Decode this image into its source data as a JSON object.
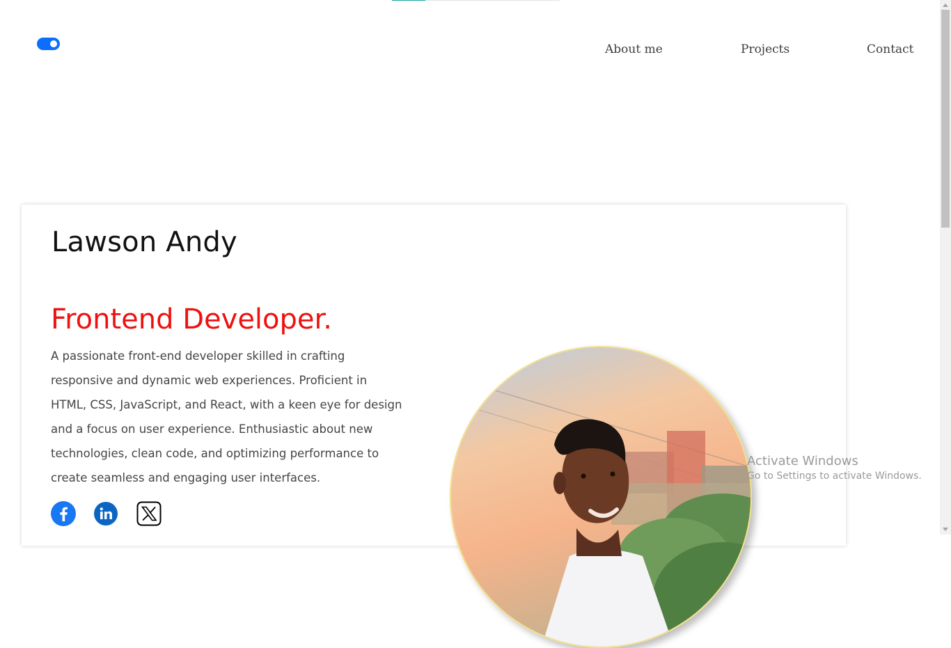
{
  "nav": {
    "about": "About me",
    "projects": "Projects",
    "contact": "Contact"
  },
  "theme_toggle": {
    "state": "on",
    "color": "#0d6efd"
  },
  "hero": {
    "name": "Lawson Andy",
    "role": "Frontend Developer.",
    "bio": "A passionate front-end developer skilled in crafting responsive and dynamic web experiences. Proficient in HTML, CSS, JavaScript, and React, with a keen eye for design and a focus on user experience. Enthusiastic about new technologies, clean code, and optimizing performance to create seamless and engaging user interfaces."
  },
  "social": [
    {
      "icon": "facebook-icon",
      "color": "#1877f2"
    },
    {
      "icon": "linkedin-icon",
      "color": "#0a66c2"
    },
    {
      "icon": "x-twitter-icon",
      "color": "#000000"
    }
  ],
  "colors": {
    "accent": "#ee1111",
    "page_bg": "#ffffff"
  },
  "watermark": {
    "line1": "Activate Windows",
    "line2": "Go to Settings to activate Windows."
  }
}
